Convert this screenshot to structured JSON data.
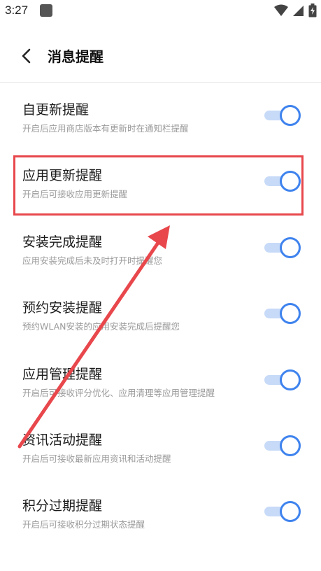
{
  "status_bar": {
    "time": "3:27",
    "icons": [
      "app-notification-icon",
      "wifi-icon",
      "cellular-signal-icon",
      "battery-charging-icon"
    ]
  },
  "header": {
    "title": "消息提醒",
    "back_icon": "back-arrow-icon"
  },
  "colors": {
    "accent": "#3f83ee",
    "toggle_track": "#c7daf8",
    "annotation": "#e8474c"
  },
  "settings": [
    {
      "title": "自更新提醒",
      "description": "开启后应用商店版本有更新时在通知栏提醒",
      "enabled": true
    },
    {
      "title": "应用更新提醒",
      "description": "开启后可接收应用更新提醒",
      "enabled": true
    },
    {
      "title": "安装完成提醒",
      "description": "应用安装完成后未及时打开时提醒您",
      "enabled": true
    },
    {
      "title": "预约安装提醒",
      "description": "预约WLAN安装的应用安装完成后提醒您",
      "enabled": true
    },
    {
      "title": "应用管理提醒",
      "description": "开启后可接收评分优化、应用清理等应用管理提醒",
      "enabled": true
    },
    {
      "title": "资讯活动提醒",
      "description": "开启后可接收最新应用资讯和活动提醒",
      "enabled": true
    },
    {
      "title": "积分过期提醒",
      "description": "开启后可接收积分过期状态提醒",
      "enabled": true
    }
  ]
}
